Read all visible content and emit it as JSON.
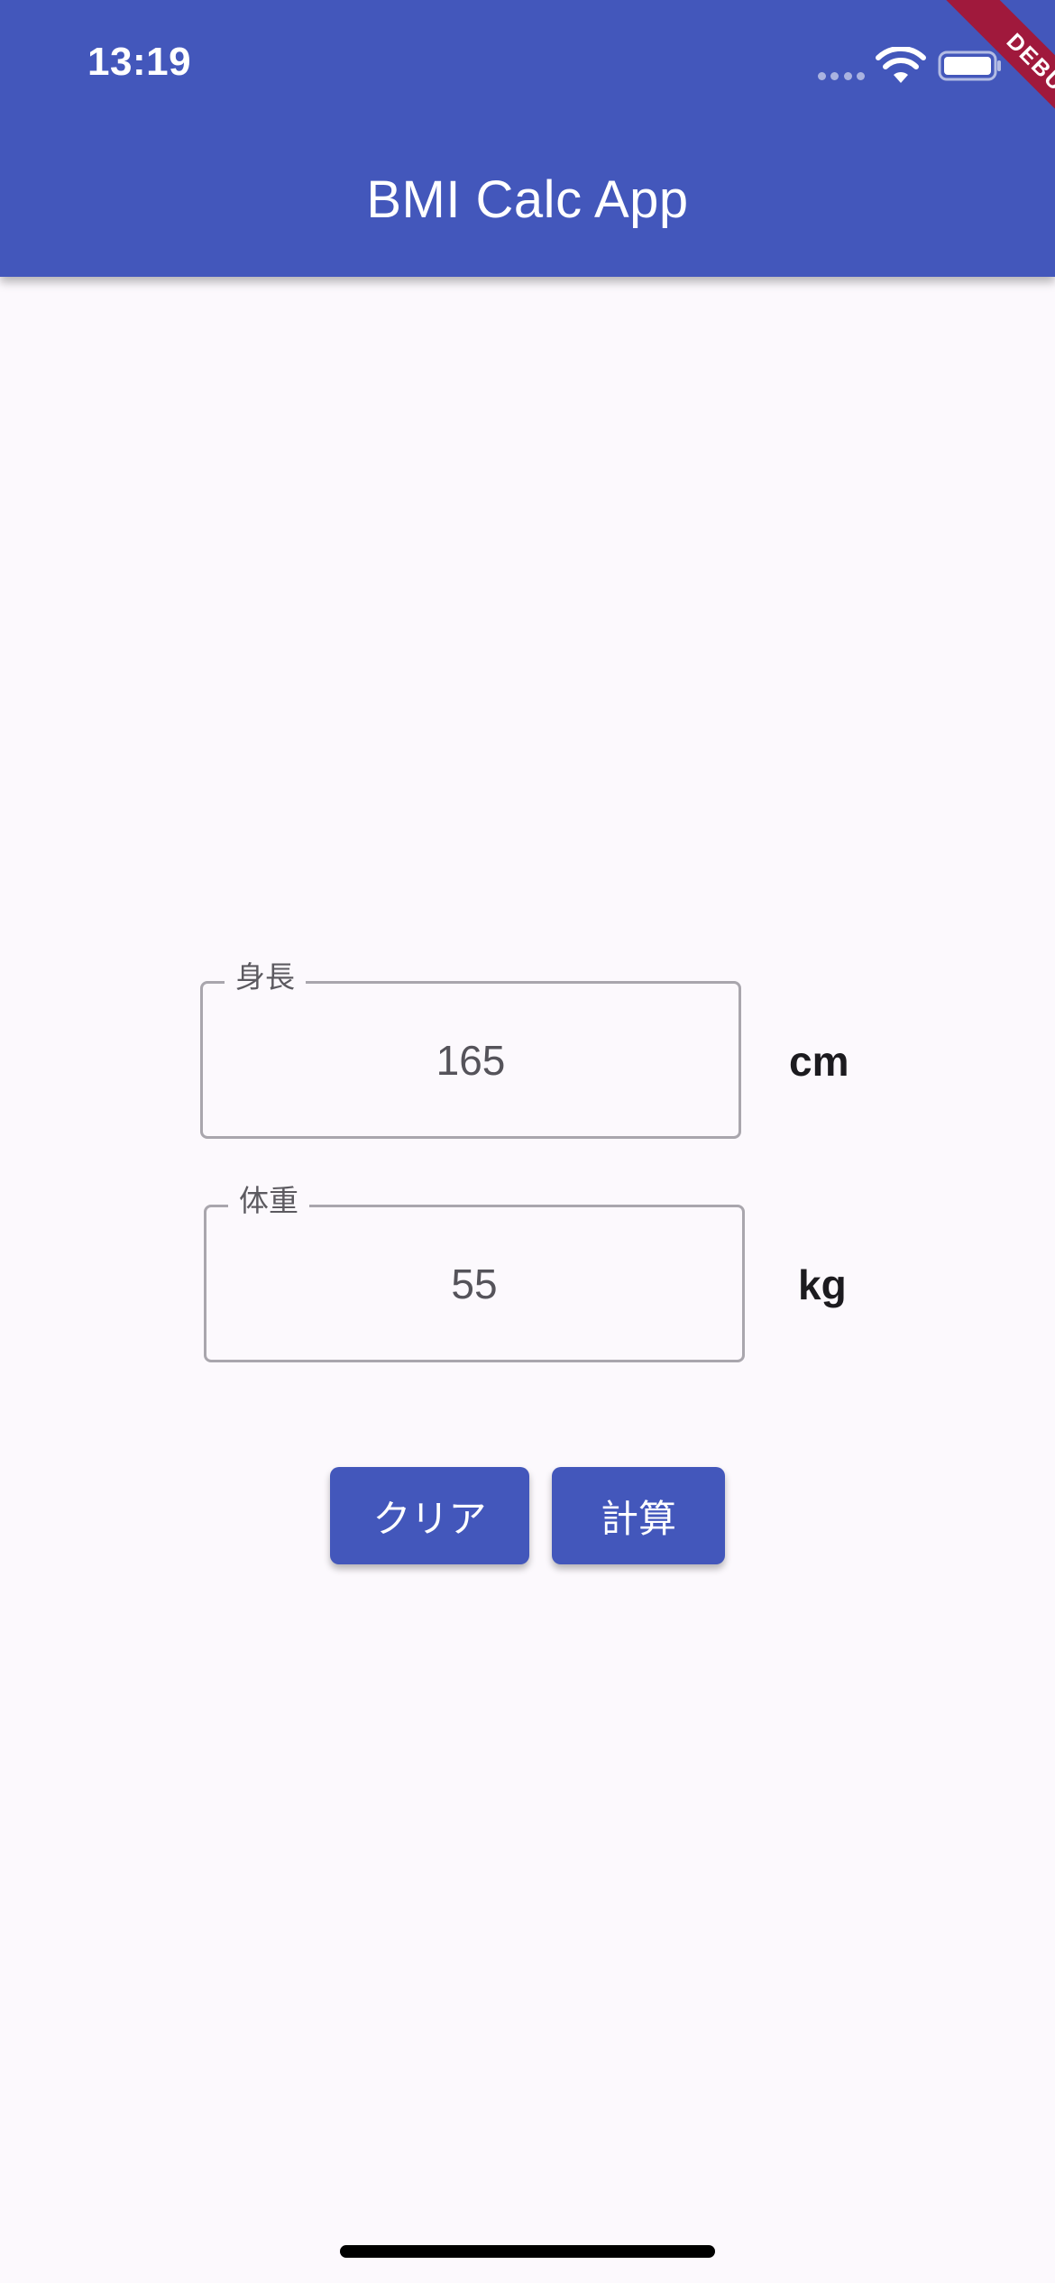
{
  "status_bar": {
    "time": "13:19",
    "icons": [
      "cellular-signal-icon",
      "wifi-icon",
      "battery-icon"
    ]
  },
  "app_bar": {
    "title": "BMI Calc App",
    "color": "#4357bb"
  },
  "debug_banner": "DEBUG",
  "form": {
    "height": {
      "label": "身長",
      "value": "165",
      "unit": "cm"
    },
    "weight": {
      "label": "体重",
      "value": "55",
      "unit": "kg"
    }
  },
  "buttons": {
    "clear_label": "クリア",
    "calculate_label": "計算"
  },
  "colors": {
    "primary": "#4357bb",
    "background": "#fcf9fd",
    "debug": "#a0193c"
  }
}
